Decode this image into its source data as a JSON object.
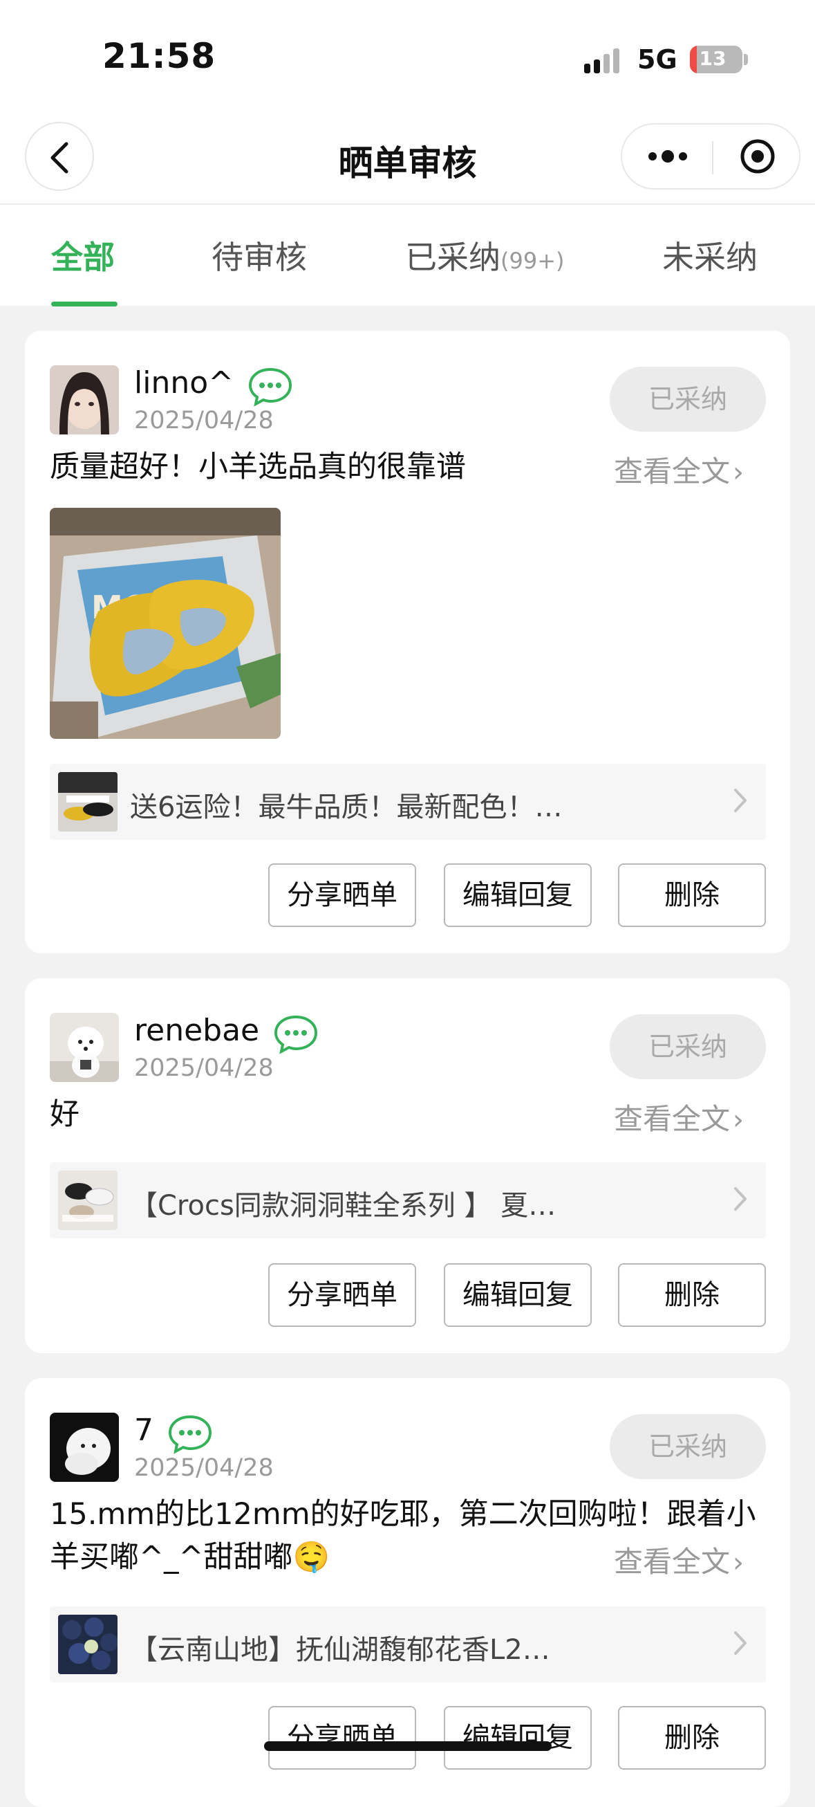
{
  "status_bar": {
    "time": "21:58",
    "network": "5G",
    "battery": "13",
    "battery_level_pct": 13,
    "battery_charging": true
  },
  "nav": {
    "title": "晒单审核",
    "icons": [
      "back-icon",
      "more-icon",
      "close-target-icon"
    ]
  },
  "tabs": [
    {
      "label": "全部",
      "active": true
    },
    {
      "label": "待审核",
      "active": false
    },
    {
      "label": "已采纳",
      "count": "(99+)",
      "active": false
    },
    {
      "label": "未采纳",
      "active": false
    }
  ],
  "colors": {
    "accent": "#34b25a",
    "pill_bg": "#ebebeb",
    "pill_text": "#a9a9a9",
    "card_bg": "#ffffff",
    "page_bg": "#f2f2f2"
  },
  "posts": [
    {
      "user": "linno^",
      "date": "2025/04/28",
      "status": "已采纳",
      "text": "质量超好！小羊选品真的很靠谱",
      "read_more": "查看全文",
      "has_photo": true,
      "product": "送6运险！最牛品质！最新配色！…",
      "actions": [
        "分享晒单",
        "编辑回复",
        "删除"
      ]
    },
    {
      "user": "renebae",
      "date": "2025/04/28",
      "status": "已采纳",
      "text": "好",
      "read_more": "查看全文",
      "has_photo": false,
      "product": "【Crocs同款洞洞鞋全系列 】 夏…",
      "actions": [
        "分享晒单",
        "编辑回复",
        "删除"
      ]
    },
    {
      "user": "7",
      "date": "2025/04/28",
      "status": "已采纳",
      "text_line1": "15.mm的比12mm的好吃耶，第二次回购啦！跟着小",
      "text_line2": "羊买嘟^_^甜甜嘟🤤",
      "read_more": "查看全文",
      "has_photo": false,
      "product": "【云南山地】抚仙湖馥郁花香L2…",
      "actions": [
        "分享晒单",
        "编辑回复",
        "删除"
      ]
    }
  ]
}
